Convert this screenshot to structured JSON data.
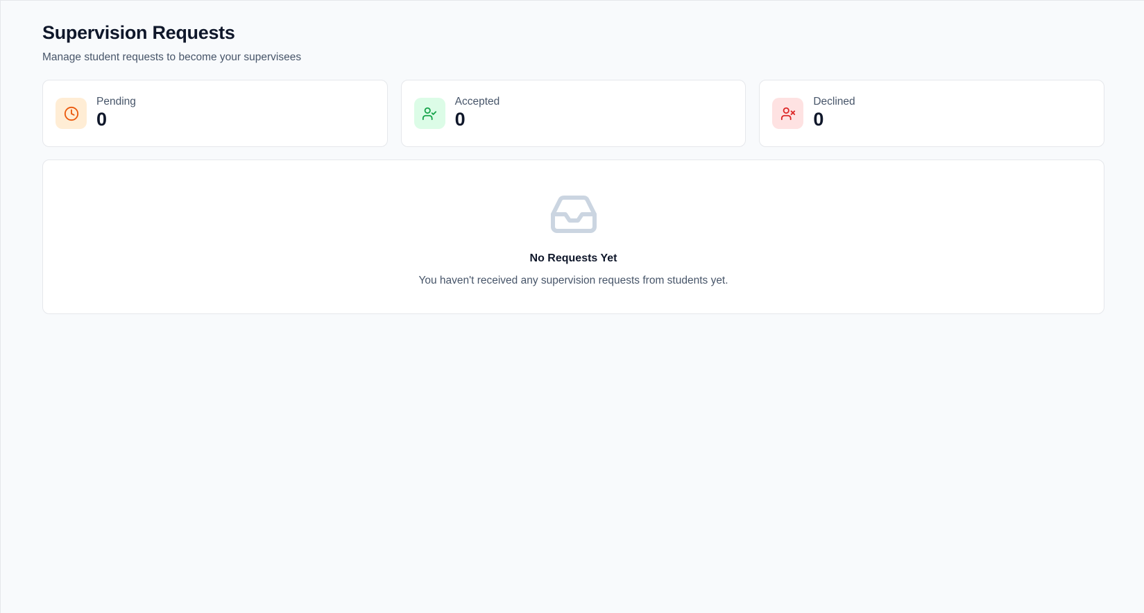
{
  "header": {
    "title": "Supervision Requests",
    "subtitle": "Manage student requests to become your supervisees"
  },
  "stats": [
    {
      "label": "Pending",
      "value": "0",
      "icon": "clock-icon",
      "color": "#ea580c",
      "bg": "#ffedd5"
    },
    {
      "label": "Accepted",
      "value": "0",
      "icon": "user-check-icon",
      "color": "#16a34a",
      "bg": "#dcfce7"
    },
    {
      "label": "Declined",
      "value": "0",
      "icon": "user-x-icon",
      "color": "#dc2626",
      "bg": "#fee2e2"
    }
  ],
  "empty_state": {
    "icon": "inbox-icon",
    "title": "No Requests Yet",
    "description": "You haven't received any supervision requests from students yet."
  }
}
